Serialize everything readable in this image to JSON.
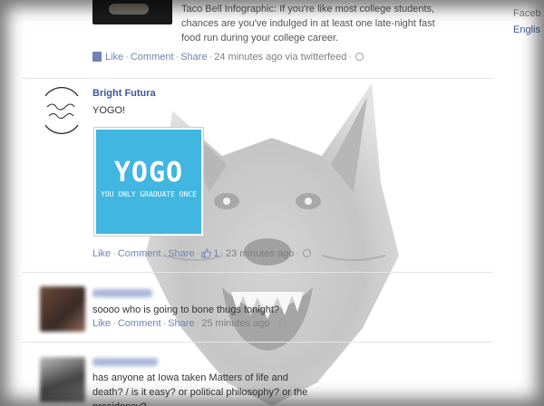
{
  "sidebar": {
    "footer_text": "Faceb",
    "language_link": "Englis"
  },
  "stories": [
    {
      "preview_text": "Taco Bell Infographic: If you're like most college students, chances are you've indulged in at least one late-night fast food run during your college career.",
      "actions": {
        "like": "Like",
        "comment": "Comment",
        "share": "Share",
        "time": "24 minutes ago via twitterfeed"
      }
    },
    {
      "author": "Bright Futura",
      "text": "YOGO!",
      "image": {
        "title": "YOGO",
        "subtitle": "YOU ONLY GRADUATE ONCE",
        "background": "#41b6e0"
      },
      "actions": {
        "like": "Like",
        "comment": "Comment",
        "share": "Share",
        "like_count": "1",
        "time": "23 minutes ago"
      }
    },
    {
      "text": "soooo who is going to bone thugs tonight?",
      "actions": {
        "like": "Like",
        "comment": "Comment",
        "share": "Share",
        "time": "25 minutes ago"
      }
    },
    {
      "text": "has anyone at Iowa taken Matters of life and death? / is it easy? or political philosophy? or the presidency?"
    }
  ],
  "separator": "·",
  "colors": {
    "link": "#3b5998",
    "action_link": "#6d84b4",
    "muted": "#7f7f7f"
  },
  "icons": {
    "share_icon": "note-icon",
    "privacy_icon": "globe-icon",
    "like_icon": "thumbs-up-icon"
  }
}
